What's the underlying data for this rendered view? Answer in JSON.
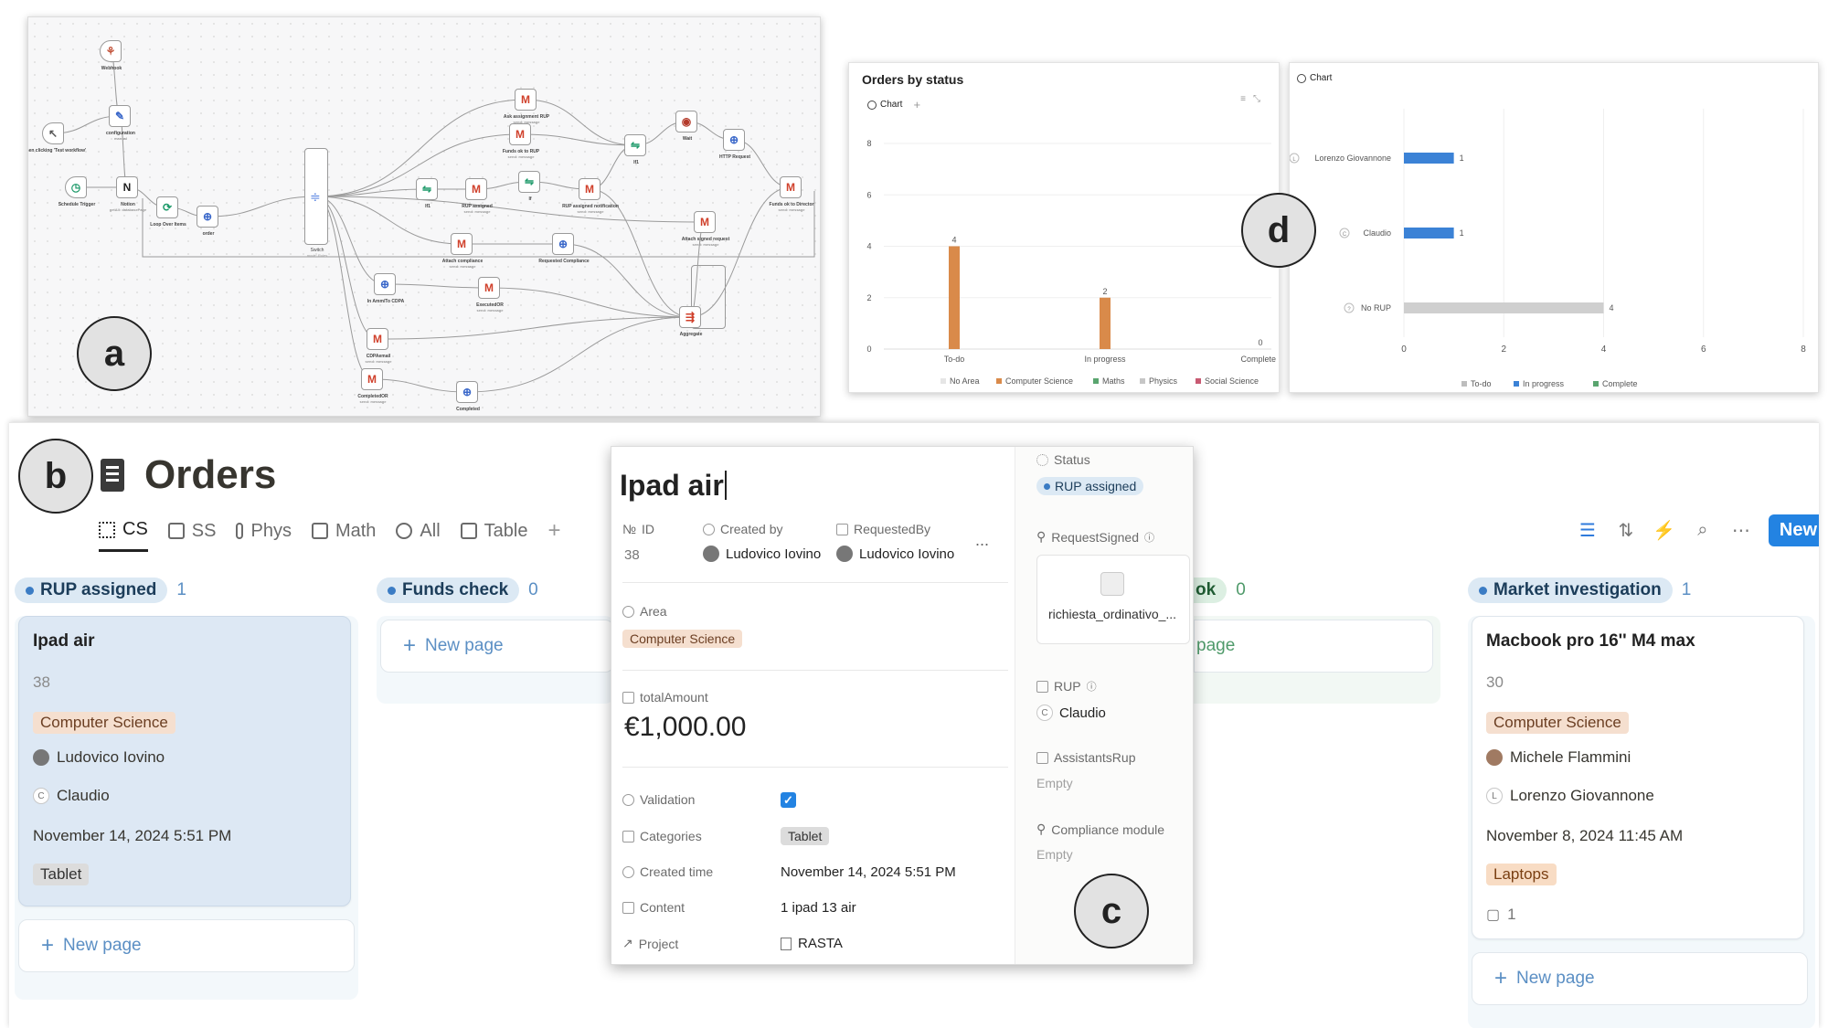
{
  "markers": {
    "a": "a",
    "b": "b",
    "c": "c",
    "d": "d"
  },
  "workflow": {
    "nodes": [
      {
        "id": "webhook",
        "label": "Webhook",
        "sub": "",
        "icon": "webhook-icon",
        "glyph": "⚘",
        "color": "#c2533a"
      },
      {
        "id": "manual",
        "label": "When clicking 'Test workflow'",
        "sub": "",
        "icon": "pointer-icon",
        "glyph": "↖",
        "color": "#555555"
      },
      {
        "id": "config",
        "label": "configuration",
        "sub": "manual",
        "icon": "pencil-icon",
        "glyph": "✎",
        "color": "#3866c9"
      },
      {
        "id": "schedule",
        "label": "Schedule Trigger",
        "sub": "",
        "icon": "clock-icon",
        "glyph": "◷",
        "color": "#1e9a6a"
      },
      {
        "id": "notion",
        "label": "Notion",
        "sub": "getAll: databasePage",
        "icon": "notion-icon",
        "glyph": "N",
        "color": "#222222"
      },
      {
        "id": "loop",
        "label": "Loop Over Items",
        "sub": "",
        "icon": "loop-icon",
        "glyph": "⟳",
        "color": "#1e9a6a"
      },
      {
        "id": "order",
        "label": "order",
        "sub": "",
        "icon": "globe-icon",
        "glyph": "⊕",
        "color": "#3866c9"
      },
      {
        "id": "switch",
        "label": "Switch",
        "sub": "mode: Rules",
        "icon": "switch-icon",
        "glyph": "",
        "color": "#4a7adf"
      },
      {
        "id": "askrup",
        "label": "Ask assignment RUP",
        "sub": "send: message",
        "icon": "gmail-icon",
        "glyph": "M",
        "color": "#d0402b"
      },
      {
        "id": "fundsrup",
        "label": "Funds ok to RUP",
        "sub": "send: message",
        "icon": "gmail-icon",
        "glyph": "M",
        "color": "#d0402b"
      },
      {
        "id": "if1",
        "label": "If1",
        "sub": "",
        "icon": "if-icon",
        "glyph": "⇋",
        "color": "#1e9a6a"
      },
      {
        "id": "rupassigned",
        "label": "RUP assigned",
        "sub": "send: message",
        "icon": "gmail-icon",
        "glyph": "M",
        "color": "#d0402b"
      },
      {
        "id": "if2",
        "label": "If",
        "sub": "",
        "icon": "if-icon",
        "glyph": "⇋",
        "color": "#1e9a6a"
      },
      {
        "id": "rupnotif",
        "label": "RUP assigned notification",
        "sub": "send: message",
        "icon": "gmail-icon",
        "glyph": "M",
        "color": "#d0402b"
      },
      {
        "id": "if3",
        "label": "If1",
        "sub": "",
        "icon": "if-icon",
        "glyph": "⇋",
        "color": "#1e9a6a"
      },
      {
        "id": "wait",
        "label": "Wait",
        "sub": "",
        "icon": "wait-icon",
        "glyph": "◉",
        "color": "#b43a2a"
      },
      {
        "id": "http",
        "label": "HTTP Request",
        "sub": "",
        "icon": "globe-icon",
        "glyph": "⊕",
        "color": "#3866c9"
      },
      {
        "id": "fundsdir",
        "label": "Funds ok to Director",
        "sub": "send: message",
        "icon": "gmail-icon",
        "glyph": "M",
        "color": "#d0402b"
      },
      {
        "id": "attachreq",
        "label": "Attach signed request",
        "sub": "send: message",
        "icon": "gmail-icon",
        "glyph": "M",
        "color": "#d0402b"
      },
      {
        "id": "attachcomp",
        "label": "Attach compliance",
        "sub": "send: message",
        "icon": "gmail-icon",
        "glyph": "M",
        "color": "#d0402b"
      },
      {
        "id": "reqcomp",
        "label": "Requested Compliance",
        "sub": "",
        "icon": "globe-icon",
        "glyph": "⊕",
        "color": "#3866c9"
      },
      {
        "id": "inamm",
        "label": "In Amm/To CDPA",
        "sub": "",
        "icon": "globe-icon",
        "glyph": "⊕",
        "color": "#3866c9"
      },
      {
        "id": "executed",
        "label": "ExecutedOR",
        "sub": "send: message",
        "icon": "gmail-icon",
        "glyph": "M",
        "color": "#d0402b"
      },
      {
        "id": "cdpa",
        "label": "CDPAemail",
        "sub": "send: message",
        "icon": "gmail-icon",
        "glyph": "M",
        "color": "#d0402b"
      },
      {
        "id": "aggregate",
        "label": "Aggregate",
        "sub": "",
        "icon": "aggregate-icon",
        "glyph": "⇶",
        "color": "#d0402b"
      },
      {
        "id": "completeor",
        "label": "CompletedOR",
        "sub": "send: message",
        "icon": "gmail-icon",
        "glyph": "M",
        "color": "#d0402b"
      },
      {
        "id": "completed",
        "label": "Completed",
        "sub": "",
        "icon": "globe-icon",
        "glyph": "⊕",
        "color": "#3866c9"
      }
    ]
  },
  "chart_data": [
    {
      "type": "bar",
      "title": "Orders by status",
      "tab_label": "Chart",
      "categories": [
        "To-do",
        "In progress",
        "Complete"
      ],
      "values": [
        4,
        2,
        0
      ],
      "bar_color": "#d98a4a",
      "ylim": [
        0,
        8
      ],
      "yticks": [
        0,
        2,
        4,
        6,
        8
      ],
      "grid": true,
      "legend_position": "bottom",
      "legend": [
        {
          "name": "No Area",
          "color": "#e6e6e6"
        },
        {
          "name": "Computer Science",
          "color": "#d98a4a"
        },
        {
          "name": "Maths",
          "color": "#5aa56f"
        },
        {
          "name": "Physics",
          "color": "#c6c6c6"
        },
        {
          "name": "Social Science",
          "color": "#c85a72"
        }
      ]
    },
    {
      "type": "bar",
      "orientation": "horizontal",
      "title": "",
      "tab_label": "Chart",
      "categories": [
        "Lorenzo Giovannone",
        "Claudio",
        "No RUP"
      ],
      "category_initials": [
        "L",
        "C",
        "?"
      ],
      "values": [
        1,
        1,
        4
      ],
      "bar_colors": [
        "#3b82d6",
        "#3b82d6",
        "#cfcfcf"
      ],
      "xlim": [
        0,
        8
      ],
      "xticks": [
        0,
        2,
        4,
        6,
        8
      ],
      "grid": true,
      "legend_position": "bottom",
      "legend": [
        {
          "name": "To-do",
          "color": "#bdbdbd"
        },
        {
          "name": "In progress",
          "color": "#3b82d6"
        },
        {
          "name": "Complete",
          "color": "#5aa56f"
        }
      ]
    }
  ],
  "board": {
    "title": "Orders",
    "tabs": [
      {
        "id": "cs",
        "label": "CS",
        "icon": "cpu-icon",
        "active": true
      },
      {
        "id": "ss",
        "label": "SS",
        "icon": "board-icon",
        "active": false
      },
      {
        "id": "phys",
        "label": "Phys",
        "icon": "thermometer-icon",
        "active": false
      },
      {
        "id": "math",
        "label": "Math",
        "icon": "calculator-icon",
        "active": false
      },
      {
        "id": "all",
        "label": "All",
        "icon": "sparkle-icon",
        "active": false
      },
      {
        "id": "table",
        "label": "Table",
        "icon": "table-icon",
        "active": false
      }
    ],
    "tab_plus": "+",
    "toolbar": {
      "new_label": "New"
    },
    "columns": {
      "rup": {
        "status": "RUP assigned",
        "count": "1",
        "card": {
          "title": "Ipad air",
          "number": "38",
          "area": "Computer Science",
          "requested_by": "Ludovico Iovino",
          "rup": "Claudio",
          "rup_initial": "C",
          "created": "November 14, 2024 5:51 PM",
          "category": "Tablet"
        },
        "new_page": "New page"
      },
      "funds": {
        "status": "Funds check",
        "count": "0",
        "new_page": "New page"
      },
      "hidden": {
        "status_tail": "ok",
        "count": "0",
        "new_page_tail": "page"
      },
      "market": {
        "status": "Market investigation",
        "count": "1",
        "card": {
          "title": "Macbook pro 16'' M4 max",
          "number": "30",
          "area": "Computer Science",
          "requested_by": "Michele Flammini",
          "rup": "Lorenzo Giovannone",
          "rup_initial": "L",
          "created": "November 8, 2024 11:45 AM",
          "category": "Laptops",
          "comments": "1"
        },
        "new_page": "New page"
      }
    }
  },
  "popup": {
    "title": "Ipad air",
    "id_label": "ID",
    "id_prefix": "№",
    "id_value": "38",
    "created_by_label": "Created by",
    "created_by": "Ludovico Iovino",
    "requested_by_label": "RequestedBy",
    "requested_by": "Ludovico Iovino",
    "more": "...",
    "area_label": "Area",
    "area": "Computer Science",
    "amount_label": "totalAmount",
    "amount": "€1,000.00",
    "validation_label": "Validation",
    "validation_checked": true,
    "categories_label": "Categories",
    "category": "Tablet",
    "created_time_label": "Created time",
    "created_time": "November 14, 2024 5:51 PM",
    "content_label": "Content",
    "content": "1 ipad 13 air",
    "project_label": "Project",
    "project": "RASTA",
    "status_label": "Status",
    "status": "RUP assigned",
    "request_signed_label": "RequestSigned",
    "file_name": "richiesta_ordinativo_...",
    "rup_label": "RUP",
    "rup": "Claudio",
    "rup_initial": "C",
    "assistants_label": "AssistantsRup",
    "assistants": "Empty",
    "compliance_label": "Compliance module",
    "compliance": "Empty"
  }
}
